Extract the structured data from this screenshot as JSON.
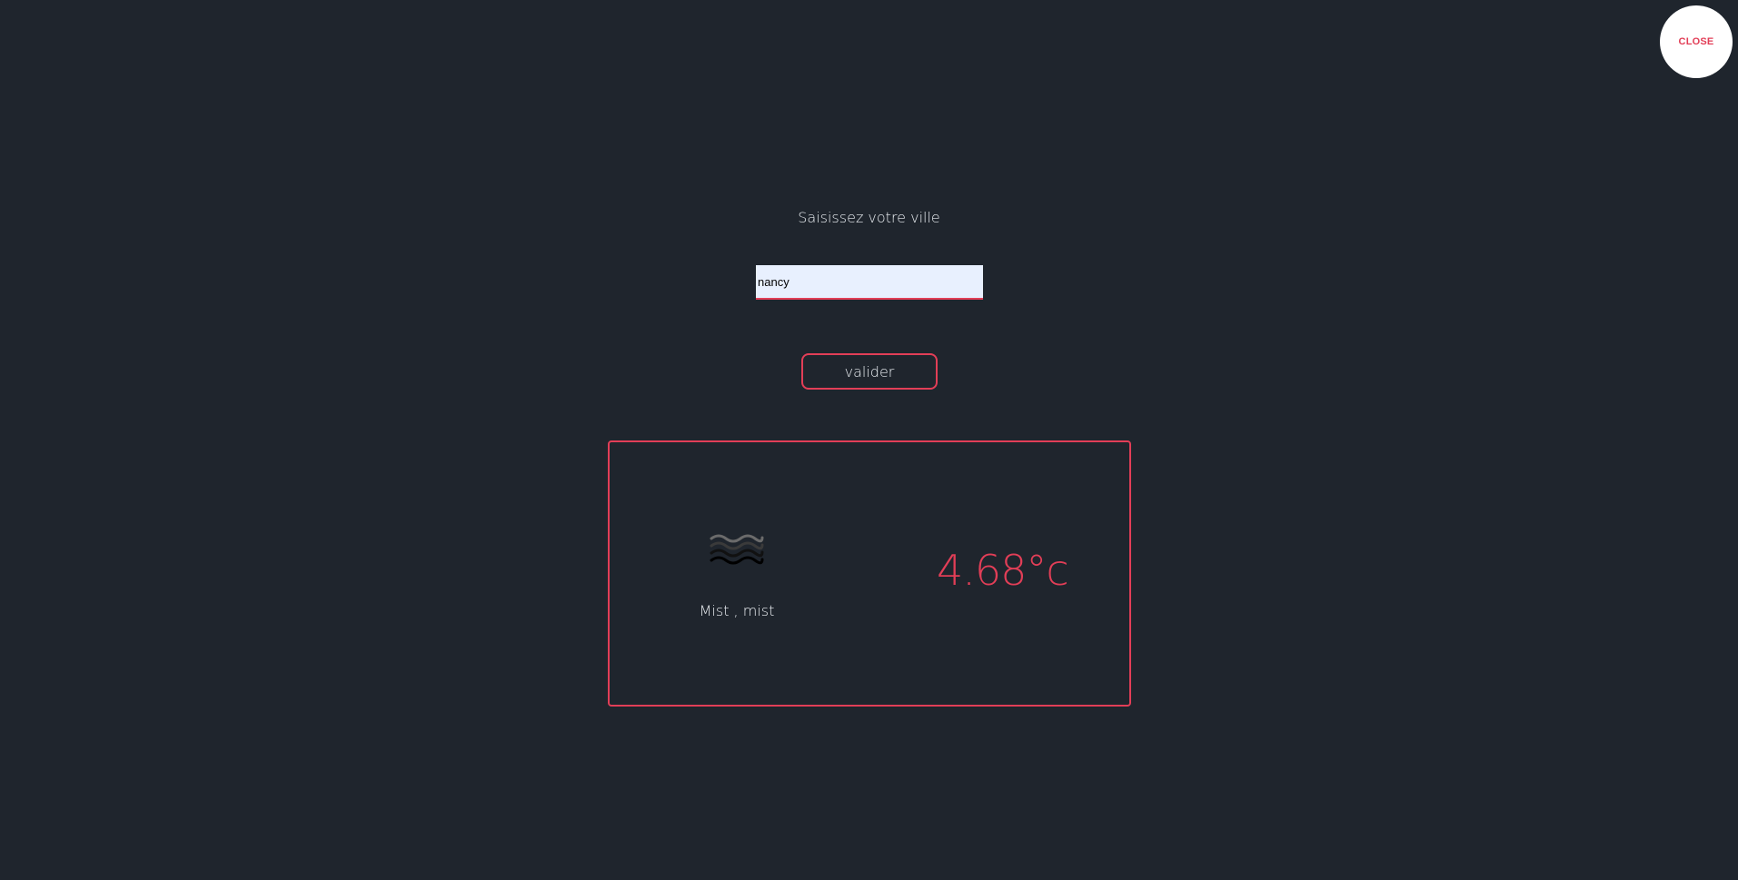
{
  "close_button": {
    "label": "CLOSE"
  },
  "form": {
    "prompt": "Saisissez votre ville",
    "city_value": "nancy",
    "submit_label": "valider"
  },
  "weather": {
    "icon": "mist-icon",
    "description": "Mist , mist",
    "temperature": "4.68°c"
  },
  "colors": {
    "background": "#1f252d",
    "accent": "#e23e57",
    "text": "#e9edf1",
    "input_bg": "#e8f0fe"
  }
}
